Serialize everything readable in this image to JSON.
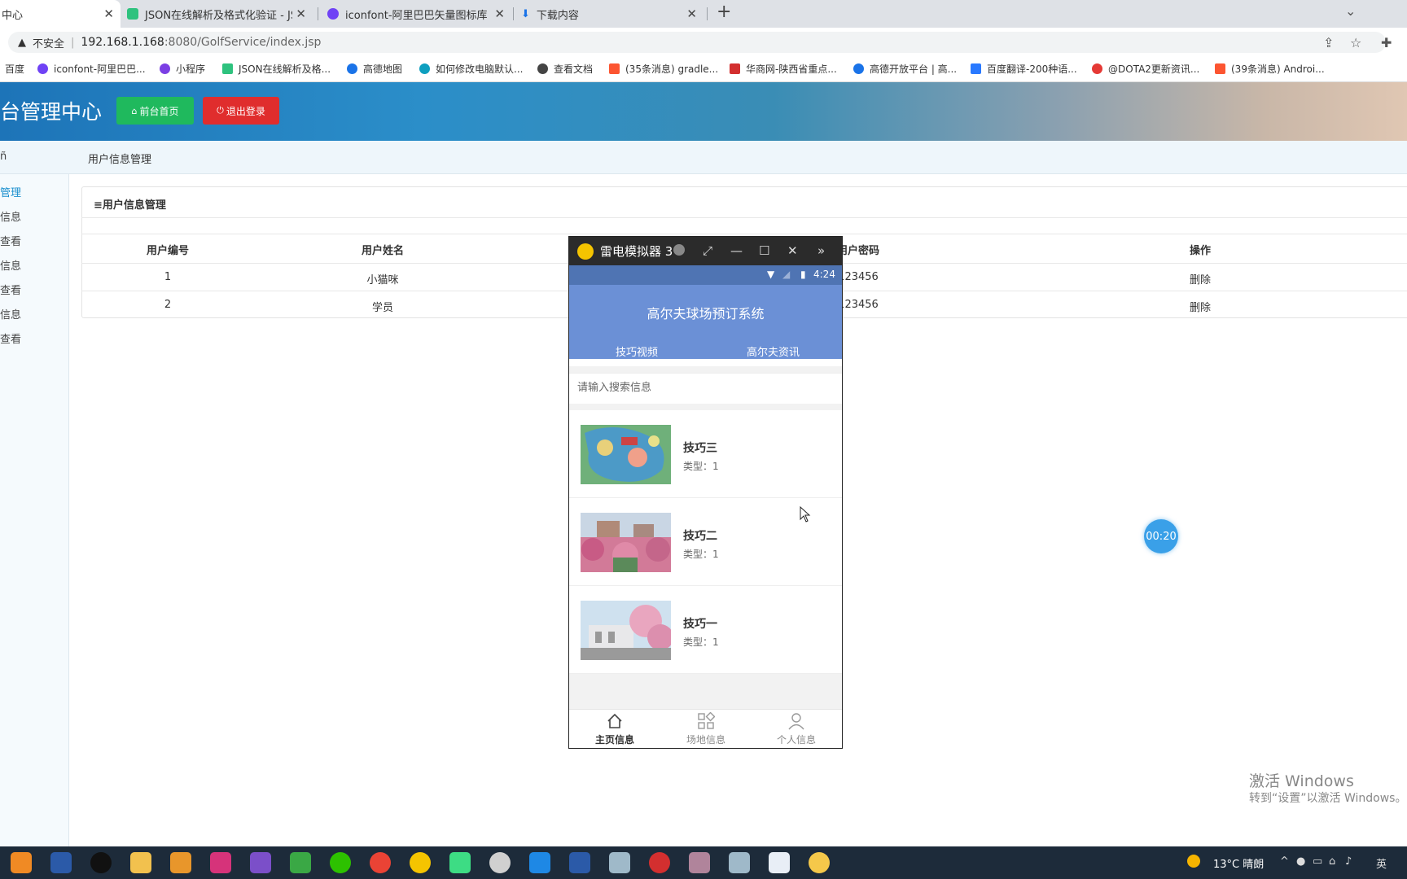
{
  "browser": {
    "tabs": [
      {
        "title": "中心",
        "active": true,
        "color": "#ffffff"
      },
      {
        "title": "JSON在线解析及格式化验证 - JS",
        "active": false,
        "color": "#2ec27e"
      },
      {
        "title": "iconfont-阿里巴巴矢量图标库",
        "active": false,
        "color": "#6f42f5"
      },
      {
        "title": "下载内容",
        "active": false,
        "color": "#1a73e8"
      }
    ],
    "security_label": "不安全",
    "url_host": "192.168.1.168",
    "url_rest": ":8080/GolfService/index.jsp",
    "bookmarks": [
      {
        "label": "百度",
        "color": ""
      },
      {
        "label": "iconfont-阿里巴巴...",
        "color": "#6f42f5"
      },
      {
        "label": "小程序",
        "color": "#7b3fe4"
      },
      {
        "label": "JSON在线解析及格...",
        "color": "#2ec27e"
      },
      {
        "label": "高德地图",
        "color": "#1a73e8"
      },
      {
        "label": "如何修改电脑默认...",
        "color": "#0e9fbf"
      },
      {
        "label": "查看文档",
        "color": "#444444"
      },
      {
        "label": "(35条消息) gradle...",
        "color": "#fc5531"
      },
      {
        "label": "华商网-陕西省重点...",
        "color": "#d32f2f"
      },
      {
        "label": "高德开放平台 | 高...",
        "color": "#1a73e8"
      },
      {
        "label": "百度翻译-200种语...",
        "color": "#2979ff"
      },
      {
        "label": "@DOTA2更新资讯...",
        "color": "#e53935"
      },
      {
        "label": "(39条消息) Androi...",
        "color": "#fc5531"
      }
    ]
  },
  "admin": {
    "title": "台管理中心",
    "home_button": "前台首页",
    "logout_button": "退出登录",
    "breadcrumb": "用户信息管理",
    "sidebar": [
      "管理",
      "信息",
      "查看",
      "信息",
      "查看",
      "信息",
      "查看"
    ],
    "panel_title": "≡用户信息管理",
    "table": {
      "headers": [
        "用户编号",
        "用户姓名",
        "用户密码",
        "操作"
      ],
      "rows": [
        {
          "id": "1",
          "name": "小猫咪",
          "password": "123456",
          "action": "删除"
        },
        {
          "id": "2",
          "name": "学员",
          "password": "123456",
          "action": "删除"
        }
      ]
    }
  },
  "recorder_timer": "00:20",
  "activation": {
    "line1": "激活 Windows",
    "line2": "转到“设置”以激活 Windows。"
  },
  "emulator": {
    "window_title": "雷电模拟器 3",
    "status_time": "4:24",
    "app_title": "高尔夫球场预订系统",
    "tabs": [
      "技巧视频",
      "高尔夫资讯"
    ],
    "active_tab": 0,
    "search_placeholder": "请输入搜索信息",
    "items": [
      {
        "title": "技巧三",
        "type": "类型：1"
      },
      {
        "title": "技巧二",
        "type": "类型：1"
      },
      {
        "title": "技巧一",
        "type": "类型：1"
      }
    ],
    "bottom_nav": [
      "主页信息",
      "场地信息",
      "个人信息"
    ]
  },
  "taskbar": {
    "weather": "13°C 晴朗",
    "ime": "英"
  }
}
